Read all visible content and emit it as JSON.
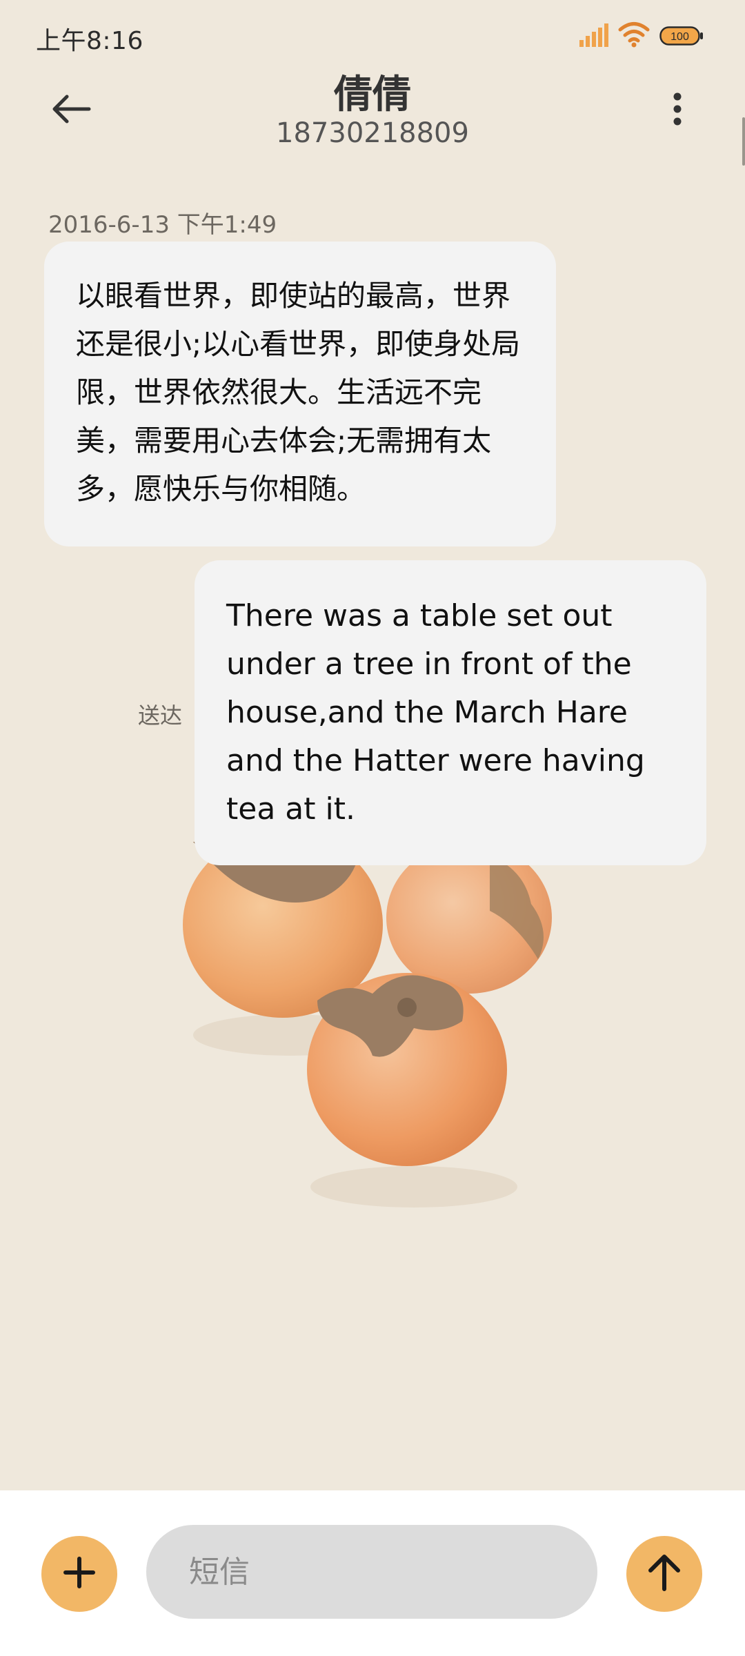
{
  "status_bar": {
    "time": "上午8:16",
    "battery": "100",
    "icons": [
      "signal-icon",
      "wifi-icon",
      "battery-icon"
    ]
  },
  "header": {
    "title": "倩倩",
    "subtitle": "18730218809",
    "back_icon": "arrow-left-icon",
    "more_icon": "more-vertical-icon"
  },
  "messages": {
    "timestamp": "2016-6-13 下午1:49",
    "incoming": "以眼看世界，即使站的最高，世界还是很小;以心看世界，即使身处局限，世界依然很大。生活远不完美，需要用心去体会;无需拥有太多，愿快乐与你相随。",
    "outgoing": "There was a table set out under a tree in front of the house,and the March Hare and the Hatter were having tea at it.",
    "status": "送达"
  },
  "composer": {
    "placeholder": "短信",
    "add_icon": "plus-icon",
    "send_icon": "arrow-up-icon"
  },
  "colors": {
    "background": "#efe8dc",
    "bubble": "#f3f3f3",
    "accent": "#f2b766"
  }
}
